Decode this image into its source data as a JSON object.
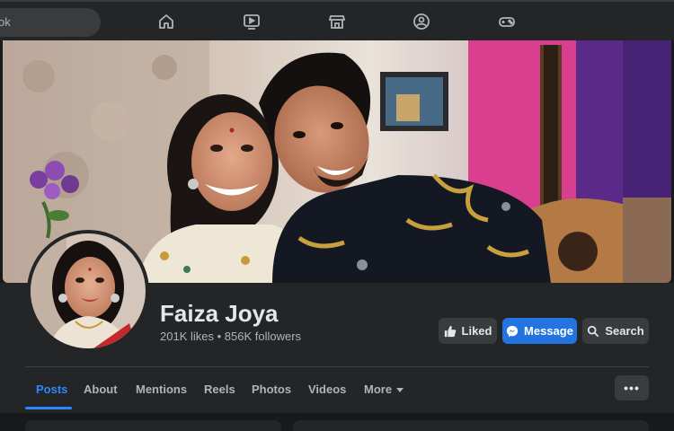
{
  "search": {
    "visible_text": "ok"
  },
  "nav": {
    "icons": [
      "home-icon",
      "video-icon",
      "marketplace-icon",
      "groups-icon",
      "gaming-icon"
    ]
  },
  "profile": {
    "name": "Faiza Joya",
    "stats": "201K likes • 856K followers"
  },
  "actions": {
    "liked": "Liked",
    "message": "Message",
    "search": "Search"
  },
  "tabs": [
    {
      "label": "Posts",
      "active": true
    },
    {
      "label": "About"
    },
    {
      "label": "Mentions"
    },
    {
      "label": "Reels"
    },
    {
      "label": "Photos"
    },
    {
      "label": "Videos"
    },
    {
      "label": "More"
    }
  ],
  "more_options": "•••",
  "colors": {
    "background": "#18191a",
    "surface": "#242526",
    "accent": "#2d88ff",
    "button_primary": "#2374e1"
  }
}
